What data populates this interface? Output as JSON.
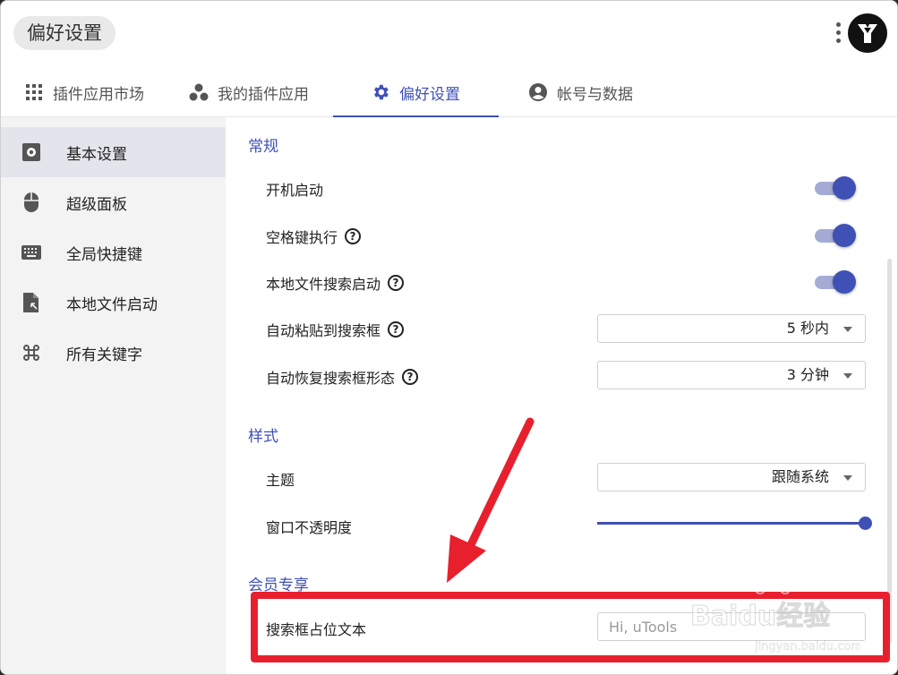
{
  "window": {
    "title": "偏好设置"
  },
  "tabs": [
    {
      "label": "插件应用市场",
      "icon": "grid-icon",
      "active": false
    },
    {
      "label": "我的插件应用",
      "icon": "bubbles-icon",
      "active": false
    },
    {
      "label": "偏好设置",
      "icon": "gear-icon",
      "active": true
    },
    {
      "label": "帐号与数据",
      "icon": "account-icon",
      "active": false
    }
  ],
  "sidebar": {
    "items": [
      {
        "label": "基本设置",
        "icon": "settings-box-icon",
        "active": true
      },
      {
        "label": "超级面板",
        "icon": "mouse-icon",
        "active": false
      },
      {
        "label": "全局快捷键",
        "icon": "keyboard-icon",
        "active": false
      },
      {
        "label": "本地文件启动",
        "icon": "file-launch-icon",
        "active": false
      },
      {
        "label": "所有关键字",
        "icon": "command-icon",
        "active": false
      }
    ]
  },
  "sections": {
    "general": {
      "title": "常规",
      "startup": {
        "label": "开机启动",
        "on": true
      },
      "space_exec": {
        "label": "空格键执行",
        "on": true
      },
      "local_file_search": {
        "label": "本地文件搜索启动",
        "on": true
      },
      "auto_paste": {
        "label": "自动粘贴到搜索框",
        "value": "5 秒内"
      },
      "auto_restore": {
        "label": "自动恢复搜索框形态",
        "value": "3 分钟"
      }
    },
    "style": {
      "title": "样式",
      "theme": {
        "label": "主题",
        "value": "跟随系统"
      },
      "opacity": {
        "label": "窗口不透明度",
        "value": 1.0
      }
    },
    "vip": {
      "title": "会员专享",
      "placeholder_text": {
        "label": "搜索框占位文本",
        "placeholder": "Hi, uTools"
      }
    }
  },
  "help_glyph": "?",
  "annotation": {
    "color": "#e8202d"
  },
  "watermark": {
    "text": "Baidu经验",
    "url_text": "jingyan.baidu.com"
  },
  "colors": {
    "accent": "#3f51b5",
    "track": "#a4acd6"
  }
}
